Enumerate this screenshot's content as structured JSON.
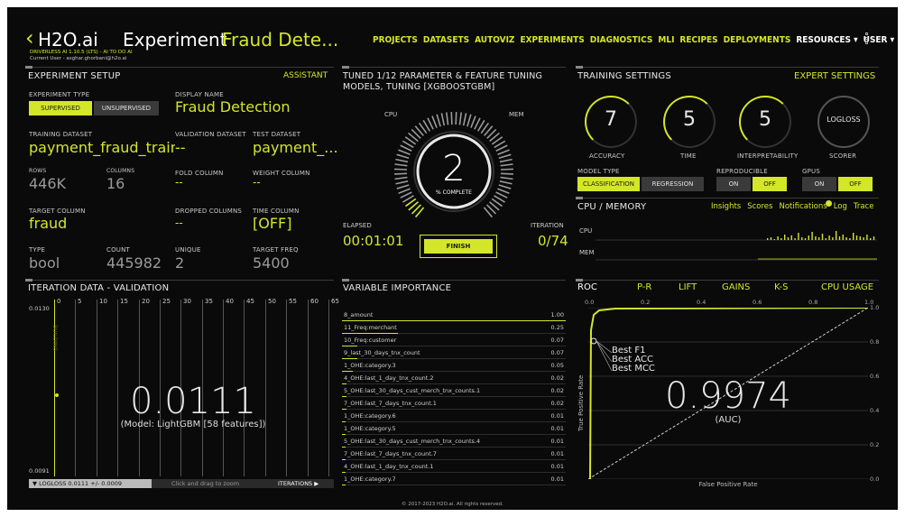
{
  "header": {
    "back": "‹",
    "brand": "H2O.ai",
    "title_prefix": "Experiment",
    "title_name": "Fraud Dete...",
    "sub1": "DRIVERLESS AI 1.10.5 (LTS) - AI TO DO AI",
    "sub2": "Current User - asghar.ghorbani@h2o.ai",
    "nav": [
      "PROJECTS",
      "DATASETS",
      "AUTOVIZ",
      "EXPERIMENTS",
      "DIAGNOSTICS",
      "MLI",
      "RECIPES",
      "DEPLOYMENTS",
      "RESOURCES ▾",
      "USER ▾"
    ]
  },
  "setup": {
    "title": "EXPERIMENT SETUP",
    "assistant": "ASSISTANT",
    "experiment_type_label": "EXPERIMENT TYPE",
    "supervised": "SUPERVISED",
    "unsupervised": "UNSUPERVISED",
    "display_name_label": "DISPLAY NAME",
    "display_name": "Fraud Detection",
    "training_dataset_label": "TRAINING DATASET",
    "training_dataset": "payment_fraud_train.cs",
    "validation_dataset_label": "VALIDATION DATASET",
    "validation_dataset": "--",
    "test_dataset_label": "TEST DATASET",
    "test_dataset": "payment_...",
    "rows_label": "ROWS",
    "rows": "446K",
    "columns_label": "COLUMNS",
    "columns": "16",
    "fold_column_label": "FOLD COLUMN",
    "fold_column": "--",
    "weight_column_label": "WEIGHT COLUMN",
    "weight_column": "--",
    "target_column_label": "TARGET COLUMN",
    "target_column": "fraud",
    "dropped_columns_label": "DROPPED COLUMNS",
    "dropped_columns": "--",
    "time_column_label": "TIME COLUMN",
    "time_column": "[OFF]",
    "type_label": "TYPE",
    "type": "bool",
    "count_label": "COUNT",
    "count": "445982",
    "unique_label": "UNIQUE",
    "unique": "2",
    "target_freq_label": "TARGET FREQ",
    "target_freq": "5400"
  },
  "tuning": {
    "title_line1": "TUNED 1/12 PARAMETER & FEATURE TUNING",
    "title_line2": "MODELS, TUNING [XGBOOSTGBM]",
    "cpu": "CPU",
    "mem": "MEM",
    "percent": "2",
    "percent_label": "% COMPLETE",
    "elapsed_label": "ELAPSED",
    "elapsed": "00:01:01",
    "finish": "FINISH",
    "iteration_label": "ITERATION",
    "iteration": "0/74",
    "progress_pct": 2
  },
  "training": {
    "title": "TRAINING SETTINGS",
    "expert": "EXPERT SETTINGS",
    "knobs": [
      {
        "value": "7",
        "label": "ACCURACY"
      },
      {
        "value": "5",
        "label": "TIME"
      },
      {
        "value": "5",
        "label": "INTERPRETABILITY"
      },
      {
        "value": "LOGLOSS",
        "label": "SCORER"
      }
    ],
    "model_type_label": "MODEL TYPE",
    "classification": "CLASSIFICATION",
    "regression": "REGRESSION",
    "reproducible_label": "REPRODUCIBLE",
    "gpus_label": "GPUS",
    "on": "ON",
    "off": "OFF"
  },
  "cpumem": {
    "title": "CPU / MEMORY",
    "links": [
      "Insights",
      "Scores",
      "Notifications",
      "Log",
      "Trace"
    ],
    "cpu": "CPU",
    "mem": "MEM"
  },
  "iteration": {
    "title": "ITERATION DATA - VALIDATION",
    "x_ticks": [
      "0",
      "5",
      "10",
      "15",
      "20",
      "25",
      "30",
      "35",
      "40",
      "45",
      "50",
      "55",
      "60",
      "65"
    ],
    "y_top": "0.0130",
    "y_bottom": "0.0091",
    "rotated": "BUILDING",
    "score": "0.0111",
    "model": "(Model: LightGBM [58 features])",
    "logloss": "▼ LOGLOSS 0.0111 +/- 0.0009",
    "zoom_hint": "Click and drag to zoom",
    "iterations": "ITERATIONS ▶"
  },
  "varimp": {
    "title": "VARIABLE IMPORTANCE",
    "rows": [
      {
        "name": "8_amount",
        "value": "1.00",
        "frac": 1.0
      },
      {
        "name": "11_Freq:merchant",
        "value": "0.25",
        "frac": 0.25
      },
      {
        "name": "10_Freq:customer",
        "value": "0.07",
        "frac": 0.07
      },
      {
        "name": "9_last_30_days_tnx_count",
        "value": "0.07",
        "frac": 0.07
      },
      {
        "name": "1_OHE:category.3",
        "value": "0.05",
        "frac": 0.05
      },
      {
        "name": "4_OHE:last_1_day_tnx_count.2",
        "value": "0.02",
        "frac": 0.02
      },
      {
        "name": "5_OHE:last_30_days_cust_merch_tnx_counts.1",
        "value": "0.02",
        "frac": 0.02
      },
      {
        "name": "7_OHE:last_7_days_tnx_count.1",
        "value": "0.02",
        "frac": 0.02
      },
      {
        "name": "1_OHE:category.6",
        "value": "0.01",
        "frac": 0.01
      },
      {
        "name": "1_OHE:category.5",
        "value": "0.01",
        "frac": 0.01
      },
      {
        "name": "5_OHE:last_30_days_cust_merch_tnx_counts.4",
        "value": "0.01",
        "frac": 0.01
      },
      {
        "name": "7_OHE:last_7_days_tnx_count.7",
        "value": "0.01",
        "frac": 0.01
      },
      {
        "name": "4_OHE:last_1_day_tnx_count.1",
        "value": "0.01",
        "frac": 0.01
      },
      {
        "name": "1_OHE:category.7",
        "value": "0.01",
        "frac": 0.01
      }
    ]
  },
  "roc": {
    "tabs": [
      "ROC",
      "P-R",
      "LIFT",
      "GAINS",
      "K-S",
      "CPU USAGE"
    ],
    "x_ticks": [
      "0.0",
      "0.2",
      "0.4",
      "0.6",
      "0.8",
      "1.0"
    ],
    "y_ticks": [
      "1.0",
      "0.8",
      "0.6",
      "0.4",
      "0.2",
      "0.0"
    ],
    "best": [
      "Best F1",
      "Best ACC",
      "Best MCC"
    ],
    "auc": "0.9974",
    "auc_label": "(AUC)",
    "xlabel": "False Positive Rate",
    "ylabel": "True Positive Rate"
  },
  "footer": "© 2017-2023 H2O.ai. All rights reserved.",
  "colors": {
    "accent": "#d4e629",
    "background": "#0a0a0a"
  }
}
